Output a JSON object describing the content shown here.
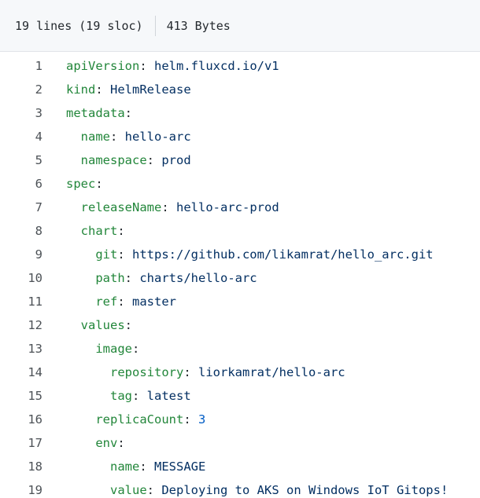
{
  "file_header": {
    "lines_info": "19 lines (19 sloc)",
    "size_info": "413 Bytes"
  },
  "code_lines": [
    {
      "number": "1",
      "indent": "",
      "key": "apiVersion",
      "sep": ":",
      "value": " helm.fluxcd.io/v1",
      "value_type": "string"
    },
    {
      "number": "2",
      "indent": "",
      "key": "kind",
      "sep": ":",
      "value": " HelmRelease",
      "value_type": "string"
    },
    {
      "number": "3",
      "indent": "",
      "key": "metadata",
      "sep": ":",
      "value": "",
      "value_type": "string"
    },
    {
      "number": "4",
      "indent": "  ",
      "key": "name",
      "sep": ":",
      "value": " hello-arc",
      "value_type": "string"
    },
    {
      "number": "5",
      "indent": "  ",
      "key": "namespace",
      "sep": ":",
      "value": " prod",
      "value_type": "string"
    },
    {
      "number": "6",
      "indent": "",
      "key": "spec",
      "sep": ":",
      "value": "",
      "value_type": "string"
    },
    {
      "number": "7",
      "indent": "  ",
      "key": "releaseName",
      "sep": ":",
      "value": " hello-arc-prod",
      "value_type": "string"
    },
    {
      "number": "8",
      "indent": "  ",
      "key": "chart",
      "sep": ":",
      "value": "",
      "value_type": "string"
    },
    {
      "number": "9",
      "indent": "    ",
      "key": "git",
      "sep": ":",
      "value": " https://github.com/likamrat/hello_arc.git",
      "value_type": "string"
    },
    {
      "number": "10",
      "indent": "    ",
      "key": "path",
      "sep": ":",
      "value": " charts/hello-arc",
      "value_type": "string"
    },
    {
      "number": "11",
      "indent": "    ",
      "key": "ref",
      "sep": ":",
      "value": " master",
      "value_type": "string"
    },
    {
      "number": "12",
      "indent": "  ",
      "key": "values",
      "sep": ":",
      "value": "",
      "value_type": "string"
    },
    {
      "number": "13",
      "indent": "    ",
      "key": "image",
      "sep": ":",
      "value": "",
      "value_type": "string"
    },
    {
      "number": "14",
      "indent": "      ",
      "key": "repository",
      "sep": ":",
      "value": " liorkamrat/hello-arc",
      "value_type": "string"
    },
    {
      "number": "15",
      "indent": "      ",
      "key": "tag",
      "sep": ":",
      "value": " latest",
      "value_type": "string"
    },
    {
      "number": "16",
      "indent": "    ",
      "key": "replicaCount",
      "sep": ":",
      "value": " 3",
      "value_type": "number"
    },
    {
      "number": "17",
      "indent": "    ",
      "key": "env",
      "sep": ":",
      "value": "",
      "value_type": "string"
    },
    {
      "number": "18",
      "indent": "      ",
      "key": "name",
      "sep": ":",
      "value": " MESSAGE",
      "value_type": "string"
    },
    {
      "number": "19",
      "indent": "      ",
      "key": "value",
      "sep": ":",
      "value": " Deploying to AKS on Windows IoT Gitops!",
      "value_type": "string"
    }
  ],
  "colors": {
    "key": "#22863a",
    "string_value": "#032f62",
    "number_value": "#005cc5",
    "line_number": "#4d5257",
    "header_bg": "#f6f8fa"
  }
}
